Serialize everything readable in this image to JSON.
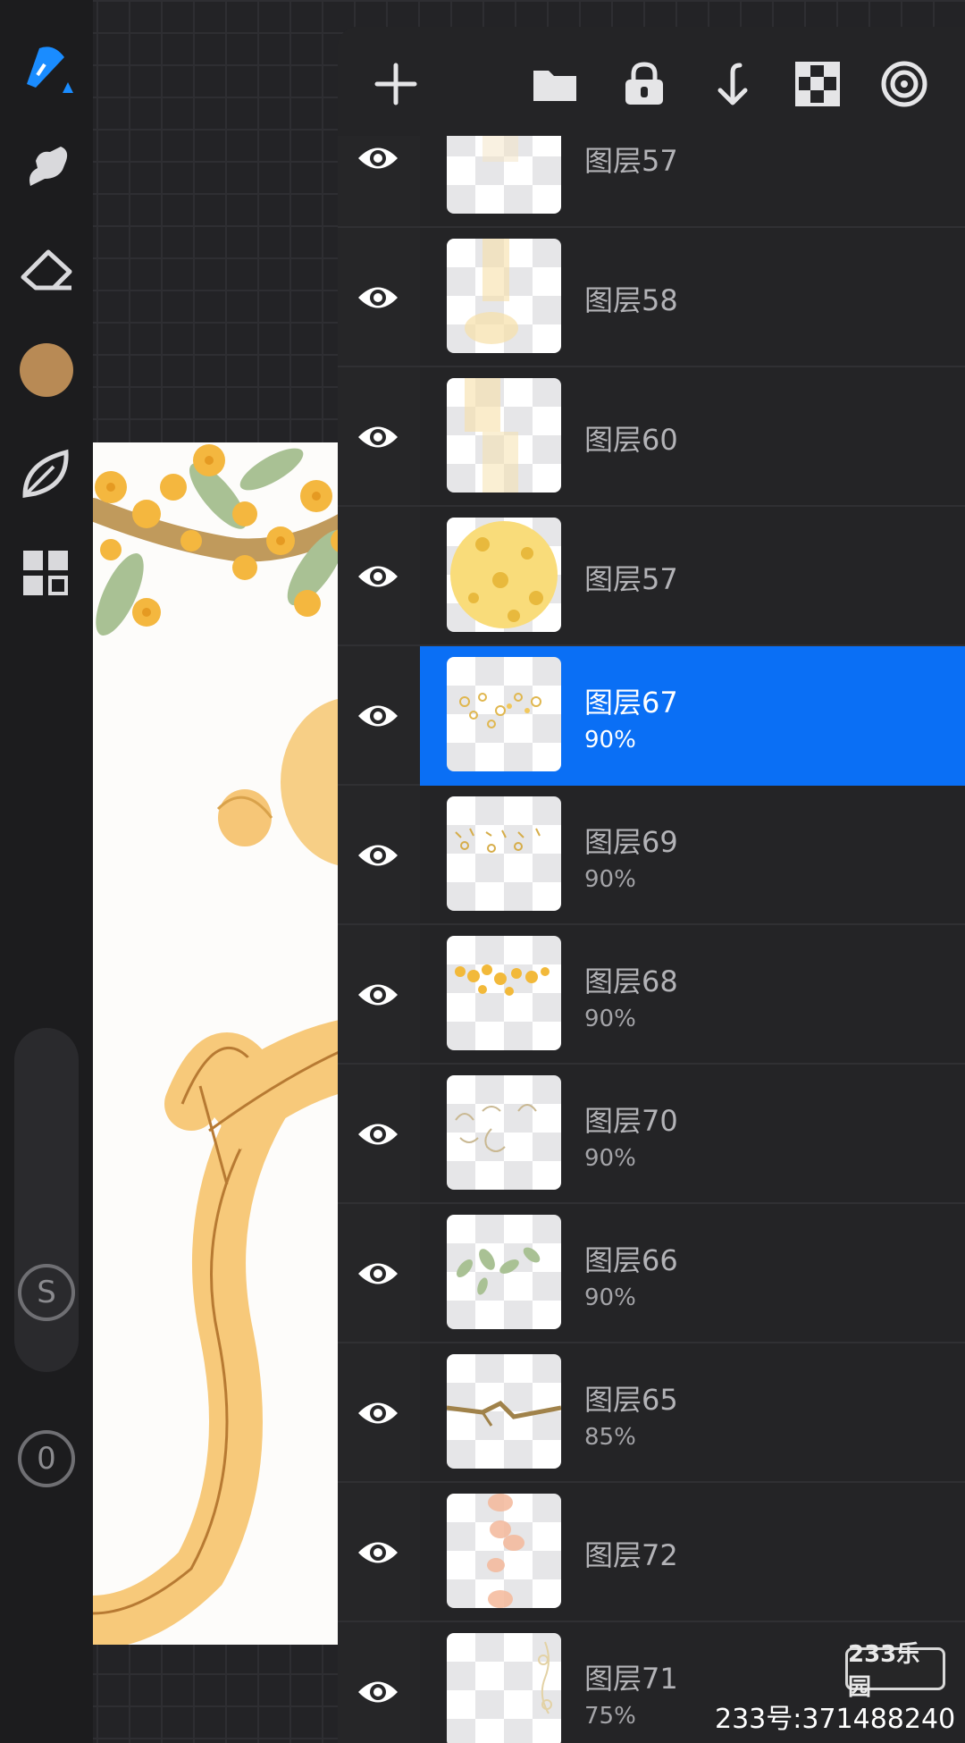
{
  "toolbar": {
    "tools": [
      "brush-icon",
      "smudge-icon",
      "eraser-icon",
      "color-swatch",
      "leaf-icon",
      "gallery-grid-icon"
    ],
    "current_color": "#b88a55",
    "accent": "#1a8cff",
    "s_button_label": "S",
    "zero_button_label": "0"
  },
  "panel": {
    "header_icons": [
      "add-icon",
      "folder-icon",
      "lock-icon",
      "merge-down-icon",
      "checkerboard-icon",
      "target-icon"
    ],
    "layers": [
      {
        "name": "图层57",
        "opacity": "",
        "thumb": "partial"
      },
      {
        "name": "图层58",
        "opacity": "",
        "thumb": "glow-vertical"
      },
      {
        "name": "图层60",
        "opacity": "",
        "thumb": "glow-blocks"
      },
      {
        "name": "图层57",
        "opacity": "",
        "thumb": "yellow-blobs"
      },
      {
        "name": "图层67",
        "opacity": "90%",
        "thumb": "flower-sketch",
        "selected": true
      },
      {
        "name": "图层69",
        "opacity": "90%",
        "thumb": "flower-sketch-2"
      },
      {
        "name": "图层68",
        "opacity": "90%",
        "thumb": "yellow-flowers"
      },
      {
        "name": "图层70",
        "opacity": "90%",
        "thumb": "line-curves"
      },
      {
        "name": "图层66",
        "opacity": "90%",
        "thumb": "green-leaves"
      },
      {
        "name": "图层65",
        "opacity": "85%",
        "thumb": "branch"
      },
      {
        "name": "图层72",
        "opacity": "",
        "thumb": "orange-blobs"
      },
      {
        "name": "图层71",
        "opacity": "75%",
        "thumb": "faint-sketch"
      }
    ]
  },
  "watermark": {
    "logo": "233乐园",
    "text": "233号:371488240"
  }
}
